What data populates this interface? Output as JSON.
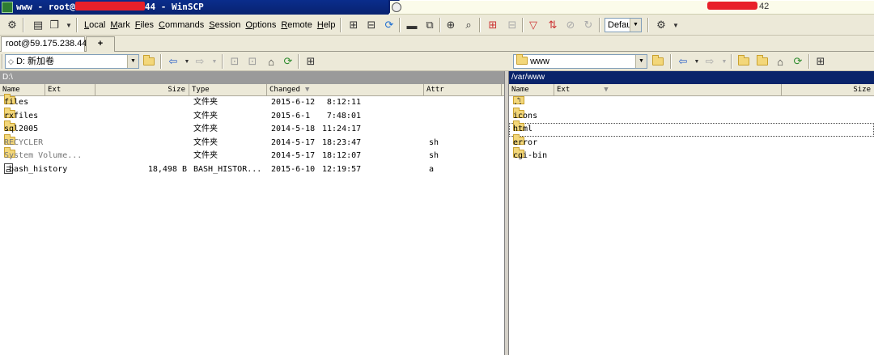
{
  "titlebar": {
    "left_prefix": "www - root@",
    "left_suffix": "44 - WinSCP",
    "right_text": "42"
  },
  "menu": [
    "Local",
    "Mark",
    "Files",
    "Commands",
    "Session",
    "Options",
    "Remote",
    "Help"
  ],
  "toolbar": {
    "transfer_preset": "Defau"
  },
  "tabs": {
    "session": "root@59.175.238.44",
    "new_tab": "+"
  },
  "left_panel": {
    "drive": "D: 新加卷",
    "path": "D:\\",
    "columns": {
      "name": "Name",
      "ext": "Ext",
      "size": "Size",
      "type": "Type",
      "changed": "Changed",
      "attr": "Attr"
    },
    "rows": [
      {
        "name": "files",
        "size": "",
        "type": "文件夹",
        "date": "2015-6-12",
        "time": "8:12:11",
        "attr": ""
      },
      {
        "name": "rxfiles",
        "size": "",
        "type": "文件夹",
        "date": "2015-6-1",
        "time": "7:48:01",
        "attr": ""
      },
      {
        "name": "sql2005",
        "size": "",
        "type": "文件夹",
        "date": "2014-5-18",
        "time": "11:24:17",
        "attr": ""
      },
      {
        "name": "RECYCLER",
        "size": "",
        "type": "文件夹",
        "date": "2014-5-17",
        "time": "18:23:47",
        "attr": "sh"
      },
      {
        "name": "System Volume...",
        "size": "",
        "type": "文件夹",
        "date": "2014-5-17",
        "time": "18:12:07",
        "attr": "sh"
      },
      {
        "name": ".bash_history",
        "size": "18,498 B",
        "type": "BASH_HISTOR...",
        "date": "2015-6-10",
        "time": "12:19:57",
        "attr": "a"
      }
    ]
  },
  "right_panel": {
    "dir": "www",
    "path": "/var/www",
    "columns": {
      "name": "Name",
      "ext": "Ext",
      "size": "Size"
    },
    "rows": [
      {
        "name": ".."
      },
      {
        "name": "icons"
      },
      {
        "name": "html"
      },
      {
        "name": "error"
      },
      {
        "name": "cgi-bin"
      }
    ]
  },
  "colors": {
    "title_bg": "#0a2d8c",
    "active_path": "#0a246a",
    "inactive_path": "#9a9a9a",
    "toolbar_bg": "#ece9d8",
    "folder": "#f3d77a"
  }
}
